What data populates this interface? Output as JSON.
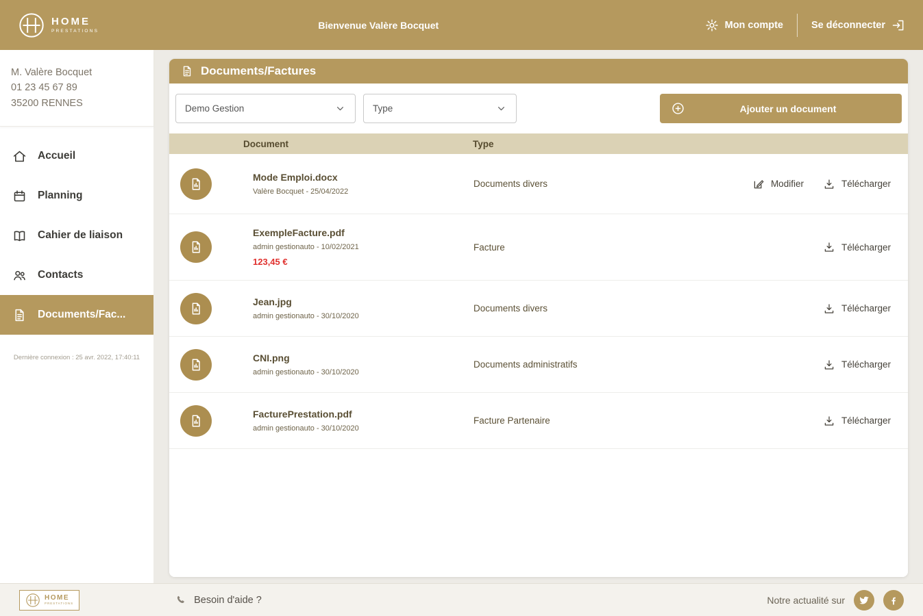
{
  "colors": {
    "gold": "#b5995e",
    "red": "#e0312e",
    "table_head": "#dbd2b5"
  },
  "header": {
    "brand_name": "HOME",
    "brand_sub": "PRESTATIONS",
    "welcome": "Bienvenue Valère Bocquet",
    "account_label": "Mon compte",
    "logout_label": "Se déconnecter"
  },
  "sidebar": {
    "user": {
      "name": "M. Valère Bocquet",
      "phone": "01 23 45 67 89",
      "city": "35200 RENNES"
    },
    "items": [
      {
        "label": "Accueil",
        "icon": "home-icon",
        "active": false
      },
      {
        "label": "Planning",
        "icon": "calendar-icon",
        "active": false
      },
      {
        "label": "Cahier de liaison",
        "icon": "book-icon",
        "active": false
      },
      {
        "label": "Contacts",
        "icon": "contacts-icon",
        "active": false
      },
      {
        "label": "Documents/Fac...",
        "icon": "document-icon",
        "active": true
      }
    ],
    "last_connection": "Dernière connexion : 25 avr. 2022, 17:40:11"
  },
  "main": {
    "title": "Documents/Factures",
    "filters": {
      "gestion_value": "Demo Gestion",
      "type_value": "Type"
    },
    "add_button_label": "Ajouter un document",
    "table": {
      "col_document": "Document",
      "col_type": "Type",
      "action_modify": "Modifier",
      "action_download": "Télécharger",
      "rows": [
        {
          "name": "Mode Emploi.docx",
          "meta": "Valère Bocquet - 25/04/2022",
          "type": "Documents divers"
        },
        {
          "name": "ExempleFacture.pdf",
          "meta": "admin gestionauto - 10/02/2021",
          "amount": "123,45 €",
          "type": "Facture"
        },
        {
          "name": "Jean.jpg",
          "meta": "admin gestionauto - 30/10/2020",
          "type": "Documents divers"
        },
        {
          "name": "CNI.png",
          "meta": "admin gestionauto - 30/10/2020",
          "type": "Documents administratifs"
        },
        {
          "name": "FacturePrestation.pdf",
          "meta": "admin gestionauto - 30/10/2020",
          "type": "Facture Partenaire"
        }
      ]
    }
  },
  "footer": {
    "help": "Besoin d'aide ?",
    "news": "Notre actualité sur"
  }
}
